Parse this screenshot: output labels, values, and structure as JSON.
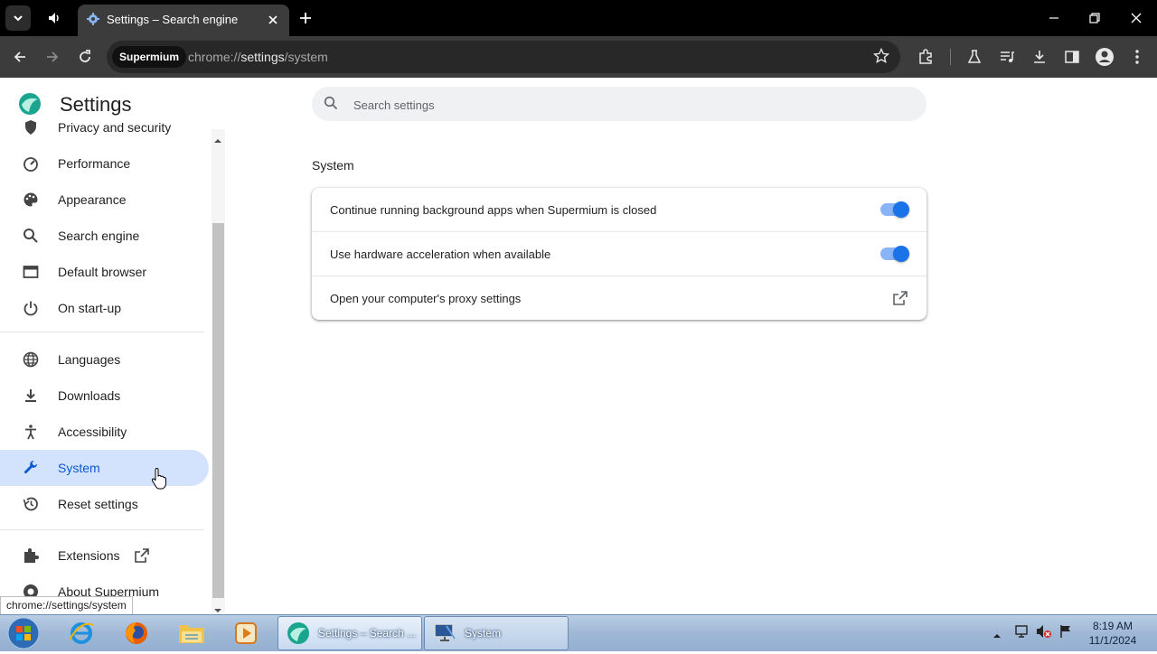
{
  "browser": {
    "tab_title": "Settings – Search engine",
    "url_chip": "Supermium",
    "url_prefix": "chrome://",
    "url_host": "settings",
    "url_path": "/system"
  },
  "settings": {
    "title": "Settings",
    "search_placeholder": "Search settings",
    "sidebar": {
      "items": [
        {
          "label": "Privacy and security",
          "icon": "shield-icon"
        },
        {
          "label": "Performance",
          "icon": "speedometer-icon"
        },
        {
          "label": "Appearance",
          "icon": "palette-icon"
        },
        {
          "label": "Search engine",
          "icon": "search-icon"
        },
        {
          "label": "Default browser",
          "icon": "browser-window-icon"
        },
        {
          "label": "On start-up",
          "icon": "power-icon"
        },
        {
          "label": "Languages",
          "icon": "globe-icon"
        },
        {
          "label": "Downloads",
          "icon": "download-icon"
        },
        {
          "label": "Accessibility",
          "icon": "accessibility-icon"
        },
        {
          "label": "System",
          "icon": "wrench-icon",
          "active": true
        },
        {
          "label": "Reset settings",
          "icon": "history-icon"
        },
        {
          "label": "Extensions",
          "icon": "puzzle-icon"
        },
        {
          "label": "About Supermium",
          "icon": "supermium-logo-icon"
        }
      ]
    },
    "section_title": "System",
    "rows": [
      {
        "label": "Continue running background apps when Supermium is closed",
        "control": "toggle",
        "on": true
      },
      {
        "label": "Use hardware acceleration when available",
        "control": "toggle",
        "on": true
      },
      {
        "label": "Open your computer's proxy settings",
        "control": "external-link"
      }
    ]
  },
  "status_url": "chrome://settings/system",
  "taskbar": {
    "tasks": [
      {
        "label": "Settings – Search ..."
      },
      {
        "label": "System"
      }
    ],
    "clock_time": "8:19 AM",
    "clock_date": "11/1/2024"
  },
  "colors": {
    "accent": "#1a73e8",
    "active_nav_bg": "#d3e3fd",
    "titlebar": "#000000",
    "toolbar": "#3c3c3c"
  }
}
